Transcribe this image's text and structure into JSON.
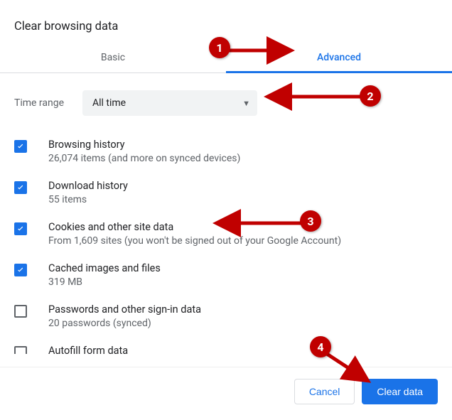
{
  "dialog": {
    "title": "Clear browsing data",
    "tabs": {
      "basic": "Basic",
      "advanced": "Advanced"
    },
    "timerange": {
      "label": "Time range",
      "value": "All time"
    },
    "items": [
      {
        "title": "Browsing history",
        "sub": "26,074 items (and more on synced devices)",
        "checked": true
      },
      {
        "title": "Download history",
        "sub": "55 items",
        "checked": true
      },
      {
        "title": "Cookies and other site data",
        "sub": "From 1,609 sites (you won't be signed out of your Google Account)",
        "checked": true
      },
      {
        "title": "Cached images and files",
        "sub": "319 MB",
        "checked": true
      },
      {
        "title": "Passwords and other sign-in data",
        "sub": "20 passwords (synced)",
        "checked": false
      },
      {
        "title": "Autofill form data",
        "sub": "",
        "checked": false
      }
    ],
    "buttons": {
      "cancel": "Cancel",
      "clear": "Clear data"
    }
  },
  "annotations": {
    "b1": "1",
    "b2": "2",
    "b3": "3",
    "b4": "4"
  }
}
